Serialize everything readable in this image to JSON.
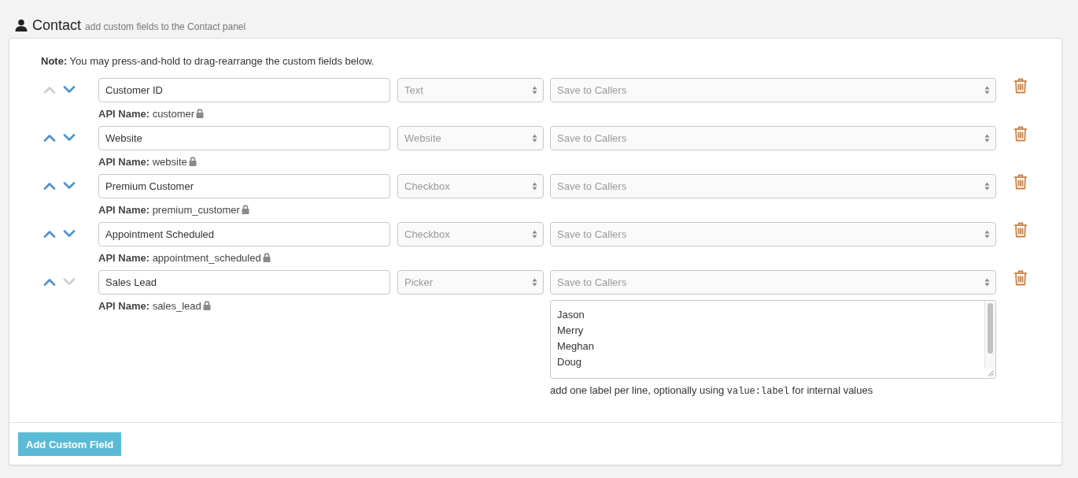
{
  "header": {
    "title": "Contact",
    "subtitle": "add custom fields to the Contact panel"
  },
  "note": "**Note:** You may press-and-hold to drag-rearrange the custom fields below.",
  "fields": [
    {
      "up_disabled": true,
      "down_disabled": false,
      "name": "Customer ID",
      "type": {
        "value": "Text",
        "disabled": true
      },
      "save": {
        "value": "Save to Callers",
        "disabled": true
      },
      "api_name": "**API Name:** customer"
    },
    {
      "up_disabled": false,
      "down_disabled": false,
      "name": "Website",
      "type": {
        "value": "Website",
        "disabled": true
      },
      "save": {
        "value": "Save to Callers",
        "disabled": true
      },
      "api_name": "**API Name:** website"
    },
    {
      "up_disabled": false,
      "down_disabled": false,
      "name": "Premium Customer",
      "type": {
        "value": "Checkbox",
        "disabled": true
      },
      "save": {
        "value": "Save to Callers",
        "disabled": true
      },
      "api_name": "**API Name:** premium_customer"
    },
    {
      "up_disabled": false,
      "down_disabled": false,
      "name": "Appointment Scheduled",
      "type": {
        "value": "Checkbox",
        "disabled": true
      },
      "save": {
        "value": "Save to Callers",
        "disabled": true
      },
      "api_name": "**API Name:** appointment_scheduled"
    },
    {
      "up_disabled": false,
      "down_disabled": true,
      "name": "Sales Lead",
      "type": {
        "value": "Picker",
        "disabled": true
      },
      "save": {
        "value": "Save to Callers",
        "disabled": true
      },
      "api_name": "**API Name:** sales_lead",
      "options": {
        "lines": [
          "Jason",
          "Merry",
          "Meghan",
          "Doug"
        ],
        "help": {
          "before": "add one label per line, optionally using",
          "code": "value:label",
          "after": "for internal values"
        }
      }
    }
  ],
  "add_button": "Add Custom Field"
}
